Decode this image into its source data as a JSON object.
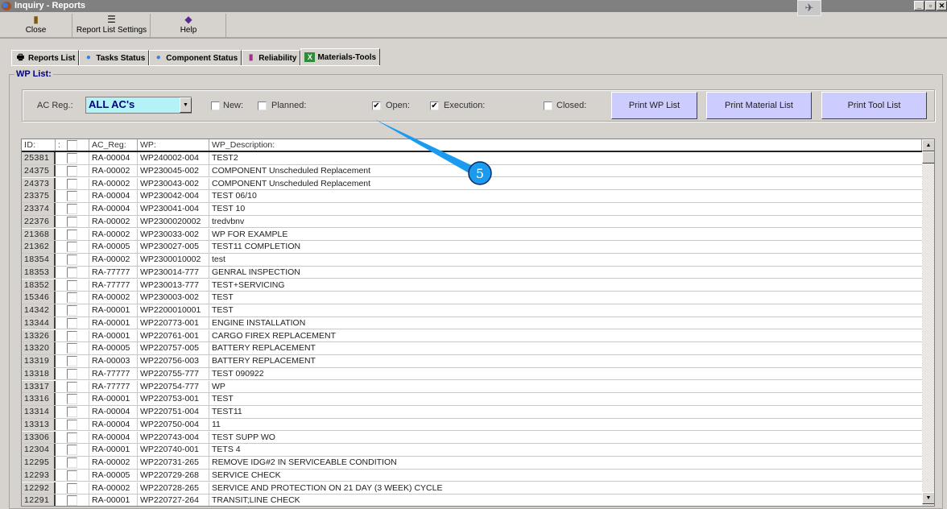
{
  "window": {
    "title": "Inquiry - Reports",
    "minimize": "_",
    "restore": "▫",
    "close": "✕"
  },
  "toolbar": {
    "close": "Close",
    "report_list_settings": "Report List Settings",
    "help": "Help"
  },
  "tabs": [
    {
      "label": "Reports List",
      "icon": "printer-icon"
    },
    {
      "label": "Tasks Status",
      "icon": "people-icon"
    },
    {
      "label": "Component Status",
      "icon": "people-icon"
    },
    {
      "label": "Reliability",
      "icon": "bar-chart-icon"
    },
    {
      "label": "Materials-Tools",
      "icon": "excel-icon"
    }
  ],
  "wp_list": {
    "label": "WP List:"
  },
  "filter": {
    "ac_reg_label": "AC Reg.:",
    "ac_reg_value": "ALL AC's",
    "new_label": "New:",
    "new_checked": false,
    "planned_label": "Planned:",
    "planned_checked": false,
    "open_label": "Open:",
    "open_checked": true,
    "execution_label": "Execution:",
    "execution_checked": true,
    "closed_label": "Closed:",
    "closed_checked": false
  },
  "buttons": {
    "print_wp": "Print WP List",
    "print_material": "Print Material List",
    "print_tool": "Print Tool List"
  },
  "annotation": {
    "number": "5",
    "color": "#1a9bf0"
  },
  "table": {
    "headers": {
      "id": "ID:",
      "sel": ":",
      "ac_reg": "AC_Reg:",
      "wp": "WP:",
      "desc": "WP_Description:"
    },
    "rows": [
      [
        "25381",
        "RA-00004",
        "WP240002-004",
        "TEST2"
      ],
      [
        "24375",
        "RA-00002",
        "WP230045-002",
        "COMPONENT Unscheduled Replacement"
      ],
      [
        "24373",
        "RA-00002",
        "WP230043-002",
        "COMPONENT Unscheduled Replacement"
      ],
      [
        "23375",
        "RA-00004",
        "WP230042-004",
        "TEST 06/10"
      ],
      [
        "23374",
        "RA-00004",
        "WP230041-004",
        "TEST 10"
      ],
      [
        "22376",
        "RA-00002",
        "WP2300020002",
        "tredvbnv"
      ],
      [
        "21368",
        "RA-00002",
        "WP230033-002",
        "WP FOR EXAMPLE"
      ],
      [
        "21362",
        "RA-00005",
        "WP230027-005",
        "TEST11 COMPLETION"
      ],
      [
        "18354",
        "RA-00002",
        "WP2300010002",
        "test"
      ],
      [
        "18353",
        "RA-77777",
        "WP230014-777",
        "GENRAL INSPECTION"
      ],
      [
        "18352",
        "RA-77777",
        "WP230013-777",
        "TEST+SERVICING"
      ],
      [
        "15346",
        "RA-00002",
        "WP230003-002",
        "TEST"
      ],
      [
        "14342",
        "RA-00001",
        "WP2200010001",
        "TEST"
      ],
      [
        "13344",
        "RA-00001",
        "WP220773-001",
        "ENGINE INSTALLATION"
      ],
      [
        "13326",
        "RA-00001",
        "WP220761-001",
        "CARGO FIREX REPLACEMENT"
      ],
      [
        "13320",
        "RA-00005",
        "WP220757-005",
        "BATTERY REPLACEMENT"
      ],
      [
        "13319",
        "RA-00003",
        "WP220756-003",
        "BATTERY REPLACEMENT"
      ],
      [
        "13318",
        "RA-77777",
        "WP220755-777",
        "TEST 090922"
      ],
      [
        "13317",
        "RA-77777",
        "WP220754-777",
        "WP"
      ],
      [
        "13316",
        "RA-00001",
        "WP220753-001",
        "TEST"
      ],
      [
        "13314",
        "RA-00004",
        "WP220751-004",
        "TEST11"
      ],
      [
        "13313",
        "RA-00004",
        "WP220750-004",
        "11"
      ],
      [
        "13306",
        "RA-00004",
        "WP220743-004",
        "TEST SUPP WO"
      ],
      [
        "12304",
        "RA-00001",
        "WP220740-001",
        "TETS 4"
      ],
      [
        "12295",
        "RA-00002",
        "WP220731-265",
        "REMOVE IDG#2 IN SERVICEABLE CONDITION"
      ],
      [
        "12293",
        "RA-00005",
        "WP220729-268",
        "SERVICE CHECK"
      ],
      [
        "12292",
        "RA-00002",
        "WP220728-265",
        "SERVICE AND PROTECTION ON 21 DAY (3 WEEK) CYCLE"
      ],
      [
        "12291",
        "RA-00001",
        "WP220727-264",
        "TRANSIT;LINE CHECK"
      ]
    ]
  }
}
